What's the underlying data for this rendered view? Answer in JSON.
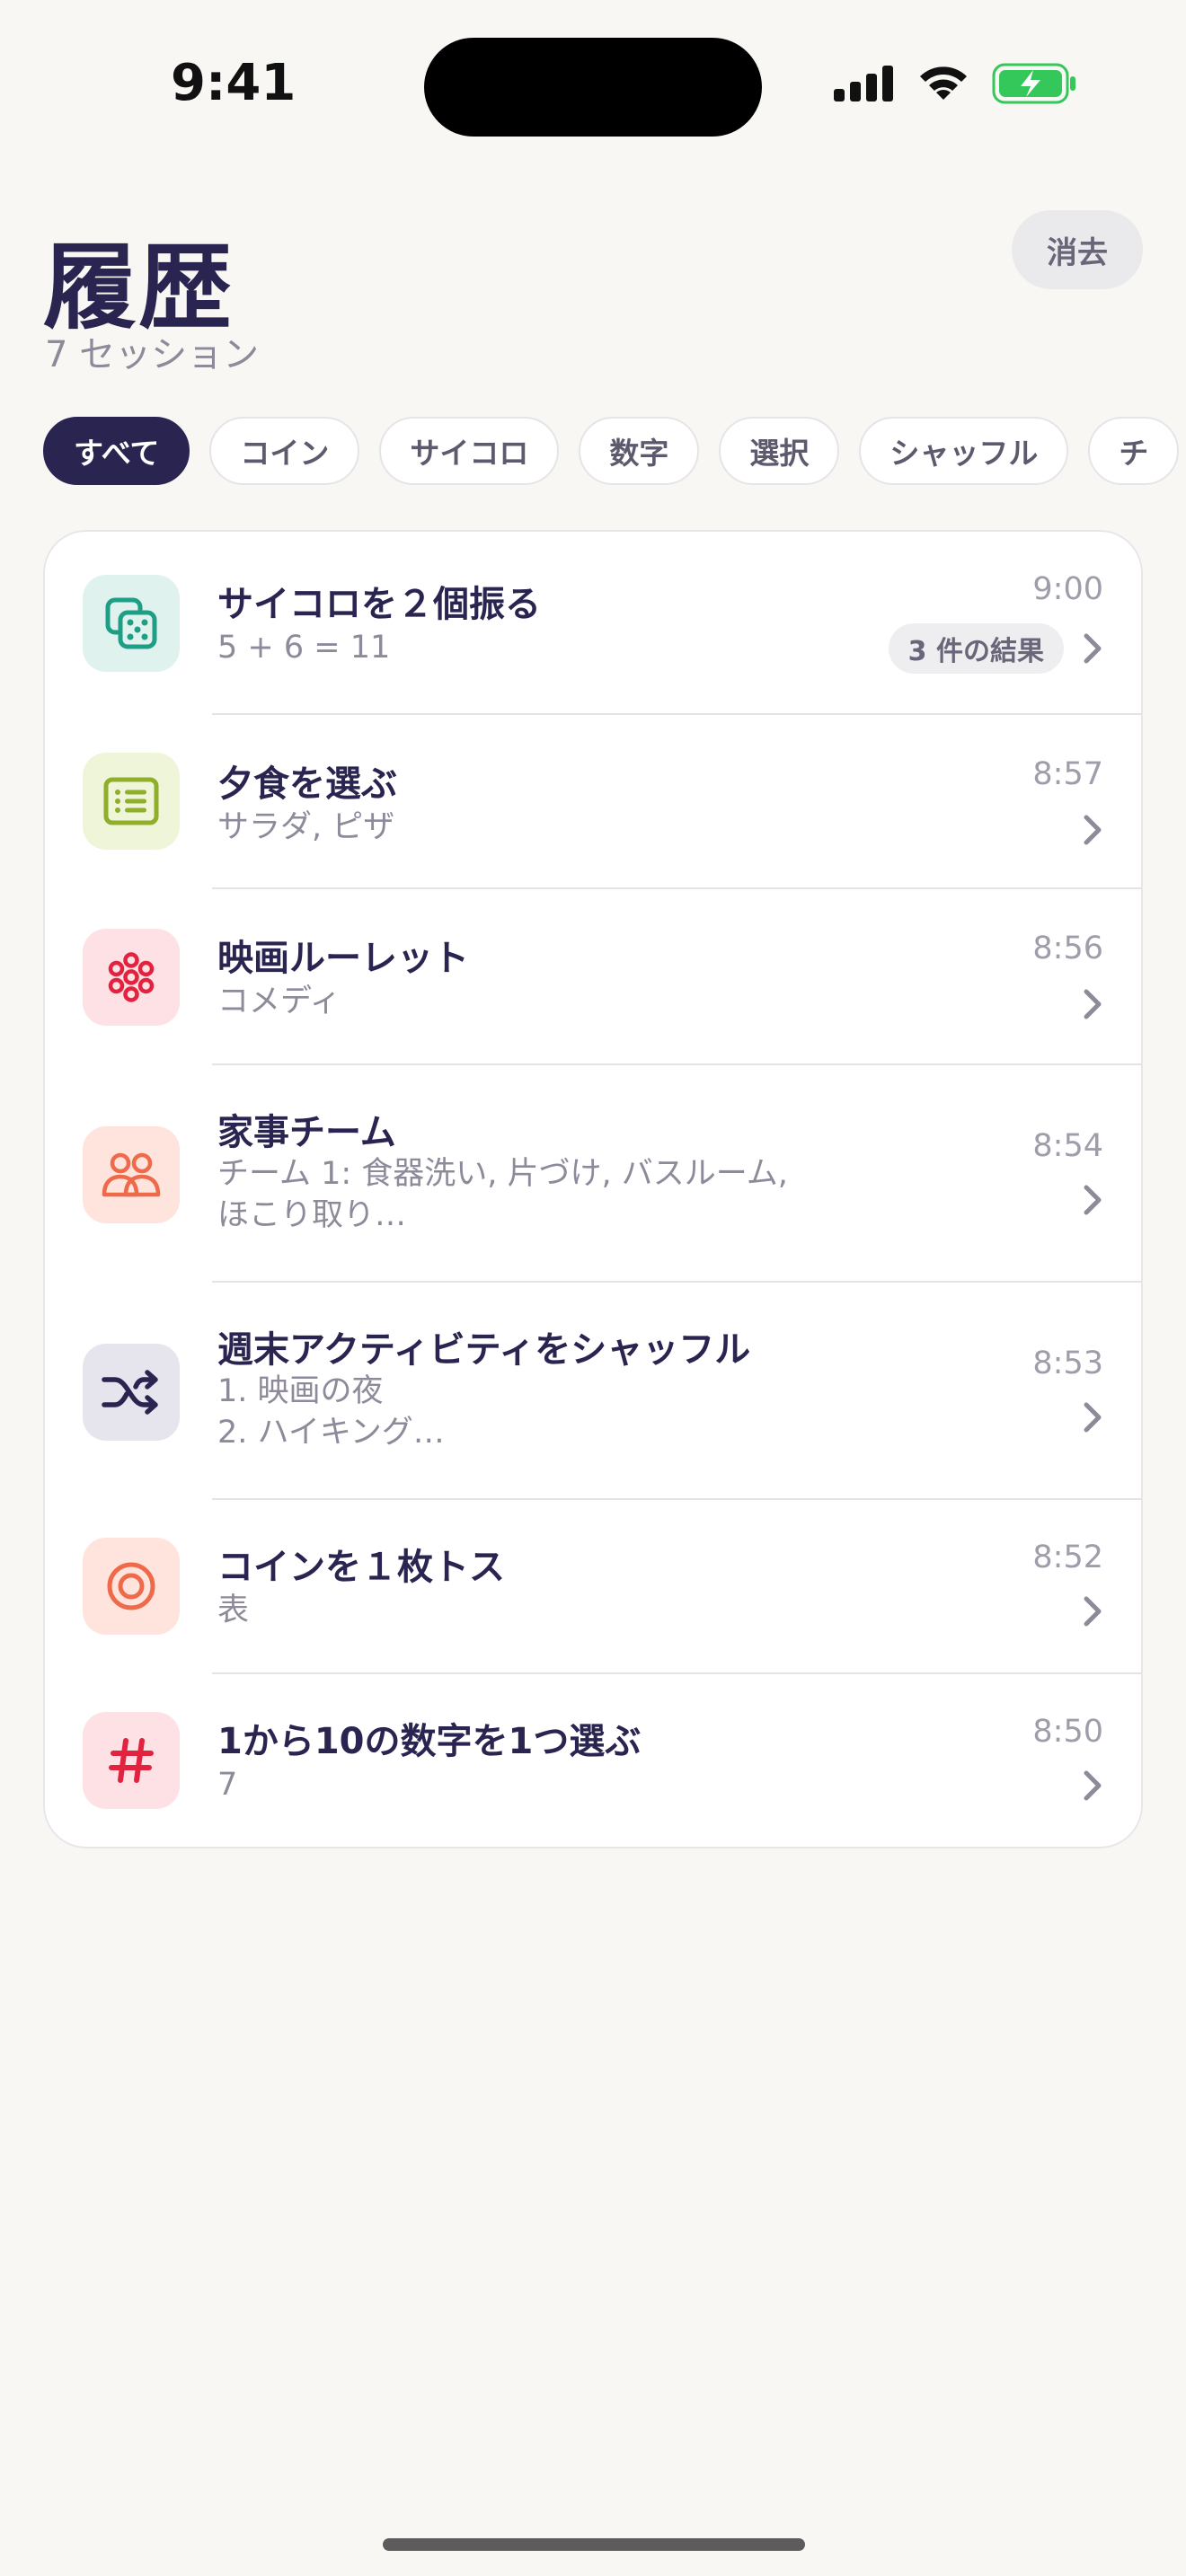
{
  "status_bar": {
    "time": "9:41"
  },
  "header": {
    "title": "履歴",
    "session_count": "7 セッション",
    "clear_label": "消去"
  },
  "filters": [
    "すべて",
    "コイン",
    "サイコロ",
    "数字",
    "選択",
    "シャッフル",
    "チ"
  ],
  "active_filter": "すべて",
  "history": [
    {
      "icon": "dice-icon",
      "title": "サイコロを２個振る",
      "subtitle": "5 + 6 = 11",
      "time": "9:00",
      "badge": "3 件の結果"
    },
    {
      "icon": "list-icon",
      "title": "夕食を選ぶ",
      "subtitle": "サラダ, ピザ",
      "time": "8:57"
    },
    {
      "icon": "roulette-icon",
      "title": "映画ルーレット",
      "subtitle": "コメディ",
      "time": "8:56"
    },
    {
      "icon": "people-icon",
      "title": "家事チーム",
      "subtitle": "チーム 1: 食器洗い, 片づけ, バスルーム,\nほこり取り…",
      "time": "8:54"
    },
    {
      "icon": "shuffle-icon",
      "title": "週末アクティビティをシャッフル",
      "subtitle": "1. 映画の夜\n2. ハイキング…",
      "time": "8:53"
    },
    {
      "icon": "coin-icon",
      "title": "コインを１枚トス",
      "subtitle": "表",
      "time": "8:52"
    },
    {
      "icon": "hash-icon",
      "title": "1から10の数字を1つ選ぶ",
      "subtitle": "7",
      "time": "8:50"
    }
  ],
  "colors": {
    "primary": "#2A2550",
    "background": "#F8F7F4",
    "battery": "#34C759"
  }
}
